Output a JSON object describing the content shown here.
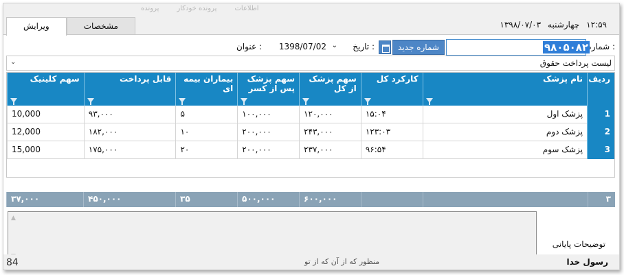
{
  "top_strip": {
    "ghost_items": [
      "پرونده",
      "پرونده خودکار",
      "اطلاعات"
    ]
  },
  "tabs": [
    {
      "label": "ویرایش",
      "active": true
    },
    {
      "label": "مشخصات",
      "active": false
    }
  ],
  "header": {
    "time": "۱۲:۵۹",
    "weekday": "چهارشنبه",
    "date": "۱۳۹۸/۰۷/۰۳"
  },
  "form": {
    "number_label": "شماره :",
    "number_value": "۹۸۰۵۰۸۲",
    "new_number_button": "شماره جدید",
    "date_label": "تاریخ :",
    "date_value": "1398/07/02",
    "title_label": "عنوان :",
    "title_value": "لیست پرداخت حقوق"
  },
  "grid": {
    "columns": [
      "ردیف",
      "نام پزشک",
      "کارکرد کل",
      "سهم پزشک از کل",
      "سهم پزشک پس از کسر",
      "بیماران بیمه ای",
      "قابل پرداخت",
      "سهم کلینیک"
    ],
    "rows": [
      {
        "idx": "1",
        "name": "پزشک اول",
        "work": "۱۵:۰۴",
        "share_total": "۱۲۰,۰۰۰",
        "share_after": "۱۰۰,۰۰۰",
        "insured": "۵",
        "payable": "۹۳,۰۰۰",
        "clinic": "10,000"
      },
      {
        "idx": "2",
        "name": "پزشک دوم",
        "work": "۱۲۳:۰۳",
        "share_total": "۲۴۳,۰۰۰",
        "share_after": "۲۰۰,۰۰۰",
        "insured": "۱۰",
        "payable": "۱۸۲,۰۰۰",
        "clinic": "12,000"
      },
      {
        "idx": "3",
        "name": "پزشک سوم",
        "work": "۹۶:۵۴",
        "share_total": "۲۳۷,۰۰۰",
        "share_after": "۲۰۰,۰۰۰",
        "insured": "۲۰",
        "payable": "۱۷۵,۰۰۰",
        "clinic": "15,000"
      }
    ]
  },
  "totals": {
    "idx": "۳",
    "name": "",
    "work": "",
    "share_total": "۶۰۰,۰۰۰",
    "share_after": "۵۰۰,۰۰۰",
    "insured": "۳۵",
    "payable": "۴۵۰,۰۰۰",
    "clinic": "۳۷,۰۰۰"
  },
  "notes": {
    "label": "توضیحات پایانی",
    "value": ""
  },
  "bottom_strip": {
    "left": "84",
    "middle": "منظور که از آن که از تو",
    "right": "رسول خدا"
  },
  "colors": {
    "header_blue": "#1887c4",
    "totals_gray": "#8aa3b6",
    "button_blue": "#4d86c6"
  }
}
